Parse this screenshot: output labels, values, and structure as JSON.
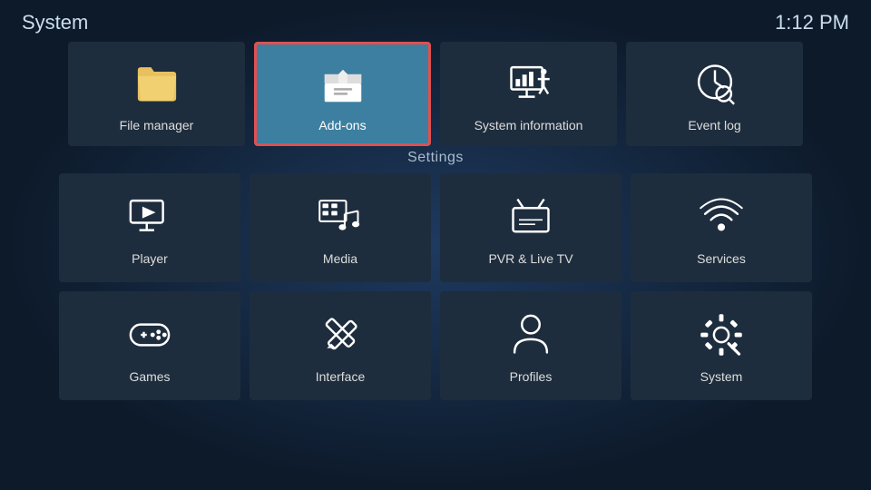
{
  "header": {
    "title": "System",
    "time": "1:12 PM"
  },
  "settings_label": "Settings",
  "top_tiles": [
    {
      "id": "file-manager",
      "label": "File manager",
      "icon": "folder"
    },
    {
      "id": "add-ons",
      "label": "Add-ons",
      "icon": "addons",
      "active": true
    },
    {
      "id": "system-information",
      "label": "System information",
      "icon": "sysinfo"
    },
    {
      "id": "event-log",
      "label": "Event log",
      "icon": "eventlog"
    }
  ],
  "settings_row1": [
    {
      "id": "player",
      "label": "Player",
      "icon": "player"
    },
    {
      "id": "media",
      "label": "Media",
      "icon": "media"
    },
    {
      "id": "pvr-live-tv",
      "label": "PVR & Live TV",
      "icon": "pvr"
    },
    {
      "id": "services",
      "label": "Services",
      "icon": "services"
    }
  ],
  "settings_row2": [
    {
      "id": "games",
      "label": "Games",
      "icon": "games"
    },
    {
      "id": "interface",
      "label": "Interface",
      "icon": "interface"
    },
    {
      "id": "profiles",
      "label": "Profiles",
      "icon": "profiles"
    },
    {
      "id": "system",
      "label": "System",
      "icon": "system"
    }
  ]
}
